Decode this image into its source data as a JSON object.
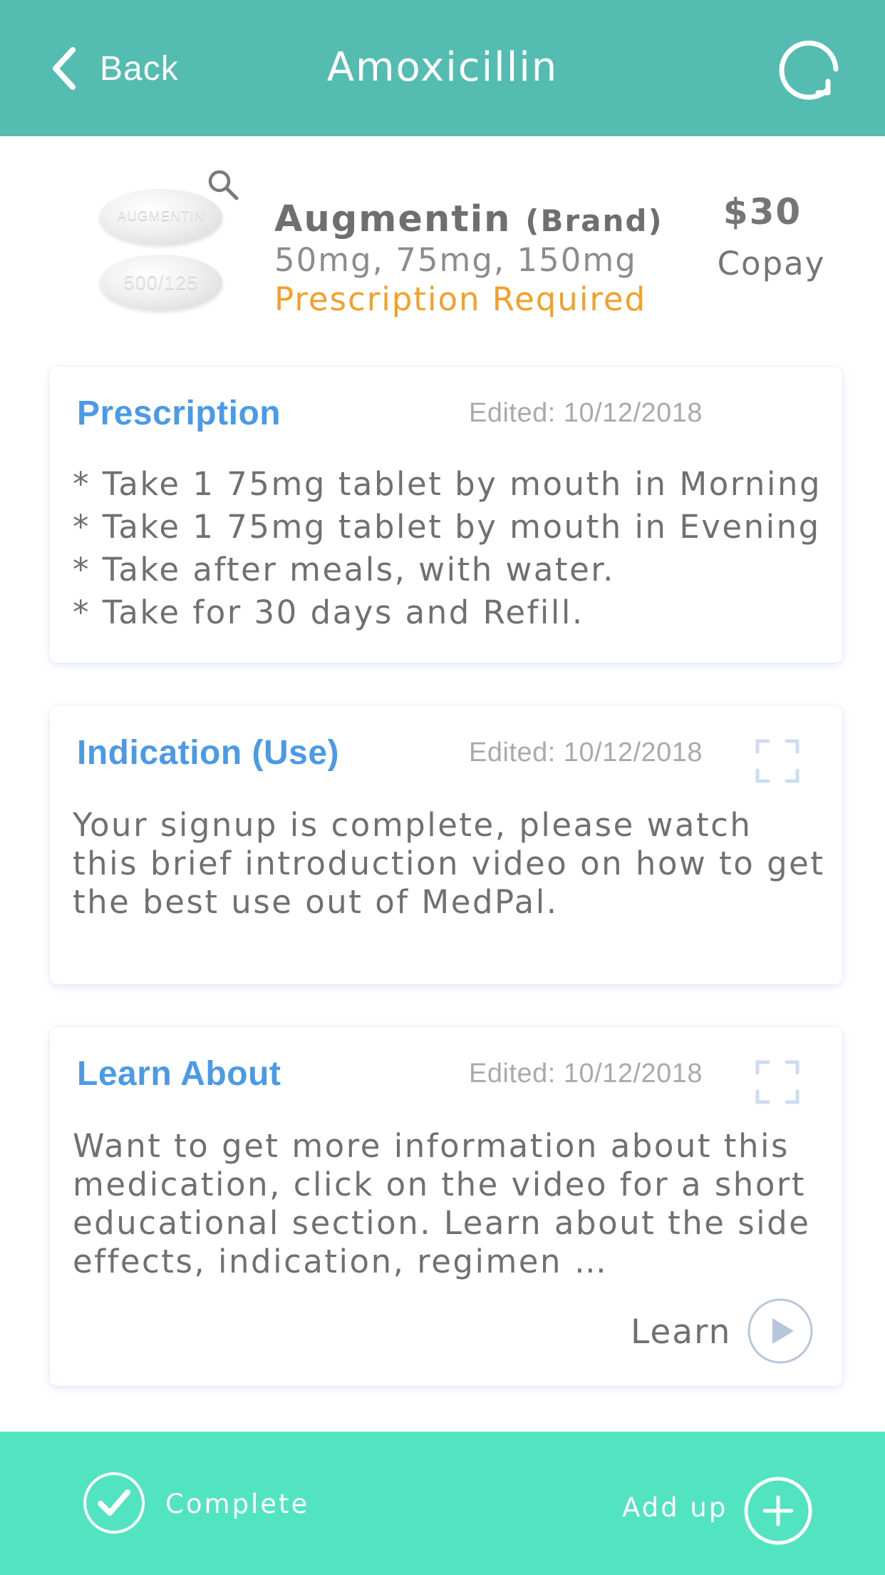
{
  "header": {
    "back_label": "Back",
    "title": "Amoxicillin",
    "bg_color": "#55bcb2",
    "refresh_icon": "refresh-icon"
  },
  "drug": {
    "pill_imprint_top": "AUGMENTIN",
    "pill_imprint_bottom": "500/125",
    "name": "Augmentin",
    "brand_tag": "(Brand)",
    "strengths": "50mg, 75mg, 150mg",
    "rx_required": "Prescription Required",
    "rx_color": "#f4a028",
    "copay_amount": "$30",
    "copay_label": "Copay"
  },
  "cards": {
    "prescription": {
      "title": "Prescription",
      "edited": "Edited: 10/12/2018",
      "lines": [
        "* Take 1 75mg tablet by mouth in Morning",
        "* Take 1 75mg tablet by mouth in Evening",
        "* Take after meals, with water.",
        "* Take for 30 days and Refill."
      ]
    },
    "indication": {
      "title": "Indication (Use)",
      "edited": "Edited: 10/12/2018",
      "body": "Your signup is complete, please watch this brief introduction video on how to get the best use out of MedPal."
    },
    "learn": {
      "title": "Learn About",
      "edited": "Edited: 10/12/2018",
      "body": "Want to get more information about this medication, click on the video for a short educational section. Learn about the side effects, indication, regimen …",
      "action_label": "Learn"
    },
    "title_color": "#4a9ae8"
  },
  "bottom_bar": {
    "complete_label": "Complete",
    "add_label": "Add up",
    "bg_color": "#52e3c1"
  }
}
